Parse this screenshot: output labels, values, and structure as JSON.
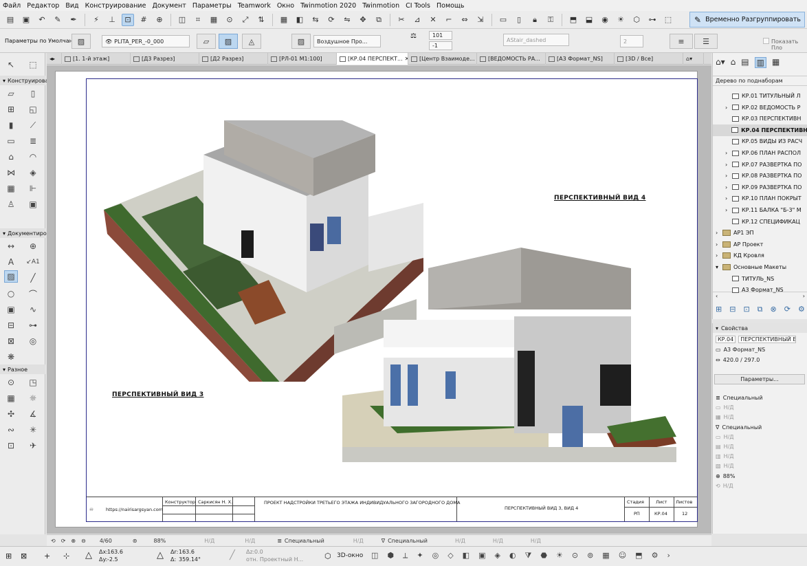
{
  "menu": [
    "Файл",
    "Редактор",
    "Вид",
    "Конструирование",
    "Документ",
    "Параметры",
    "Teamwork",
    "Окно",
    "Twinmotion 2020",
    "Twinmotion",
    "CI Tools",
    "Помощь"
  ],
  "toolbar": {
    "regroup_label": "Временно Разгруппировать"
  },
  "infobox": {
    "defaults_label": "Параметры по Умолчанию",
    "layer": "PLITA_PER_-0_000",
    "material": "Воздушное Про...",
    "pen1": "101",
    "pen2": "-1",
    "linetype": "AStair_dashed",
    "count": "2",
    "show_label": "Показать Пло"
  },
  "tabs": [
    "[1. 1-й этаж]",
    "[Д3 Разрез]",
    "[Д2 Разрез]",
    "[РЛ-01 М1:100]",
    "[КР.04 ПЕРСПЕКТ...",
    "[Центр Взаимоде...",
    "[ВЕДОМОСТЬ РА...",
    "[А3 Формат_NS]",
    "[3D / Все]"
  ],
  "toolbox": {
    "section1": "Конструирова",
    "section2": "Документиро",
    "section3": "Разное",
    "text_tool": "A",
    "label_tool": "A1"
  },
  "sheet": {
    "view3_title": "ПЕРСПЕКТИВНЫЙ ВИД 3",
    "view4_title": "ПЕРСПЕКТИВНЫЙ ВИД 4",
    "stamp": {
      "url": "https://nairisargsyan.com",
      "role": "Конструктор",
      "author": "Саркисян Н. Х.",
      "project": "ПРОЕКТ НАДСТРОЙКИ ТРЕТЬЕГО ЭТАЖА ИНДИВИДУАЛЬНОГО ЗАГОРОДНОГО ДОМА",
      "sheet_title": "ПЕРСПЕКТИВНЫЙ ВИД 3, ВИД 4",
      "stage_label": "Стадия",
      "sheet_label": "Лист",
      "sheets_label": "Листов",
      "stage": "РП",
      "sheet_no": "КР.04",
      "sheets_total": "12"
    }
  },
  "navigator": {
    "header": "Дерево по поднаборам",
    "items": [
      {
        "label": "КР.01 ТИТУЛЬНЫЙ Л"
      },
      {
        "label": "КР.02 ВЕДОМОСТЬ Р"
      },
      {
        "label": "КР.03 ПЕРСПЕКТИВН"
      },
      {
        "label": "КР.04 ПЕРСПЕКТИВН"
      },
      {
        "label": "КР.05 ВИДЫ ИЗ РАСЧ"
      },
      {
        "label": "КР.06 ПЛАН РАСПОЛ"
      },
      {
        "label": "КР.07 РАЗВЕРТКА ПО"
      },
      {
        "label": "КР.08 РАЗВЕРТКА ПО"
      },
      {
        "label": "КР.09 РАЗВЕРТКА ПО"
      },
      {
        "label": "КР.10 ПЛАН ПОКРЫТ"
      },
      {
        "label": "КР.11 БАЛКА \"Б-3\" М"
      },
      {
        "label": "КР.12 СПЕЦИФИКАЦ"
      },
      {
        "label": "АР1 ЭП"
      },
      {
        "label": "АР Проект"
      },
      {
        "label": "КД Кровля"
      },
      {
        "label": "Основные Макеты"
      },
      {
        "label": "ТИТУЛЬ_NS"
      },
      {
        "label": "А3 Формат_NS"
      }
    ]
  },
  "properties": {
    "header": "Свойства",
    "id": "КР.04",
    "name": "ПЕРСПЕКТИВНЫЙ ВИД",
    "format": "А3 Формат_NS",
    "size": "420.0 / 297.0",
    "params_button": "Параметры...",
    "special1": "Специальный",
    "special2": "Специальный",
    "na": "Н/Д",
    "zoom": "88%"
  },
  "status": {
    "page": "4/60",
    "zoom": "88%",
    "na": "Н/Д",
    "special": "Специальный"
  },
  "bottom": {
    "dx": "163.6",
    "dy": "-2.5",
    "dr": "163.6",
    "angle": "359.14°",
    "dz": "0.0",
    "ref": "отн. Проектный Н...",
    "view3d": "3D-окно",
    "dx_label": "Δx:",
    "dy_label": "Δy:",
    "dr_label": "Δr:",
    "da_label": "Δ:",
    "dz_label": "Δz:"
  }
}
